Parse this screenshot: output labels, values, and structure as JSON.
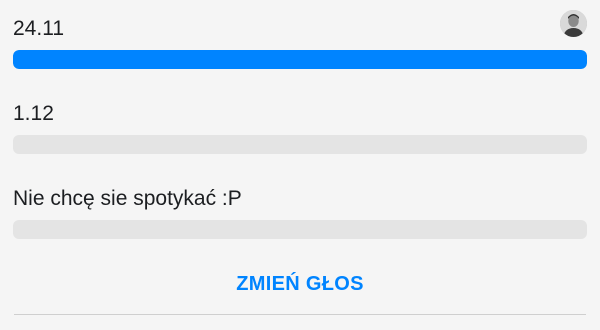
{
  "poll": {
    "options": [
      {
        "label": "24.11",
        "fraction": 1.0,
        "voter_avatar": "user-avatar"
      },
      {
        "label": "1.12",
        "fraction": 0.0
      },
      {
        "label": "Nie chcę sie spotykać :P",
        "fraction": 0.0
      }
    ],
    "change_vote_label": "ZMIEŃ GŁOS"
  },
  "colors": {
    "accent": "#0084ff",
    "bar_track": "#e4e4e4",
    "background": "#f5f5f5",
    "text": "#1c1e21",
    "divider": "#cfcfcf"
  }
}
